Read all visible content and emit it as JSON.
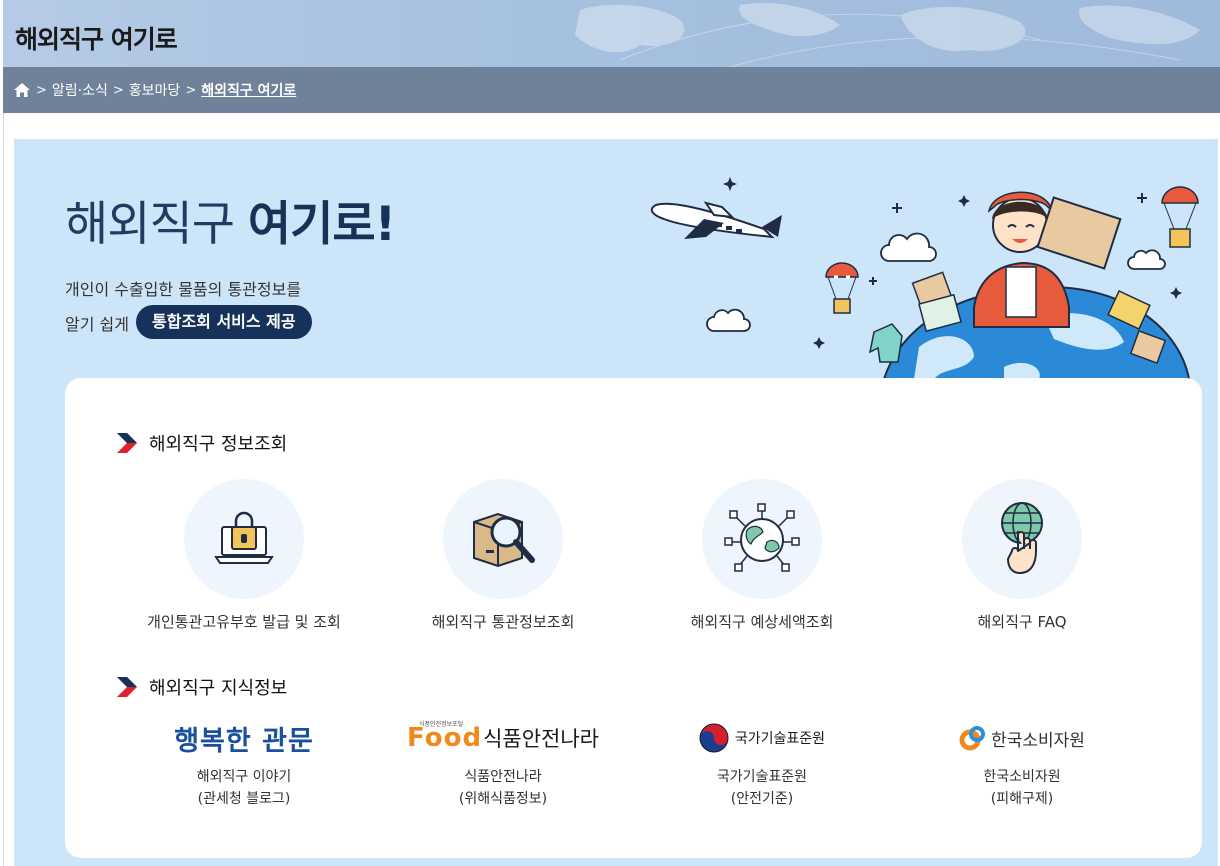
{
  "header": {
    "title": "해외직구 여기로"
  },
  "breadcrumb": {
    "items": [
      "알림·소식",
      "홍보마당",
      "해외직구 여기로"
    ],
    "separator": ">"
  },
  "hero": {
    "title_main": "해외직구",
    "title_bold": "여기로!",
    "desc_line1": "개인이 수출입한 물품의 통관정보를",
    "desc_line2": "알기 쉽게",
    "pill": "통합조회 서비스 제공"
  },
  "sections": {
    "info_lookup": {
      "title": "해외직구 정보조회",
      "items": [
        {
          "label": "개인통관고유부호 발급 및 조회",
          "icon": "laptop-lock-icon"
        },
        {
          "label": "해외직구 통관정보조회",
          "icon": "box-magnifier-icon"
        },
        {
          "label": "해외직구 예상세액조회",
          "icon": "globe-network-icon"
        },
        {
          "label": "해외직구 FAQ",
          "icon": "globe-hand-icon"
        }
      ]
    },
    "knowledge": {
      "title": "해외직구 지식정보",
      "items": [
        {
          "logo_text": "행복한 관문",
          "line1": "해외직구 이야기",
          "line2": "(관세청 블로그)"
        },
        {
          "logo_small": "식품안전정보포털",
          "logo_text": "Food",
          "logo_text2": "식품안전나라",
          "line1": "식품안전나라",
          "line2": "(위해식품정보)"
        },
        {
          "logo_text": "국가기술표준원",
          "line1": "국가기술표준원",
          "line2": "(안전기준)"
        },
        {
          "logo_text": "한국소비자원",
          "line1": "한국소비자원",
          "line2": "(피해구제)"
        }
      ]
    }
  },
  "colors": {
    "hero_bg": "#cde5f8",
    "navy": "#16325a",
    "breadcrumb_bg": "#6f8299",
    "title_bar_bg": "#a7c1e0",
    "accent_red": "#e0202f",
    "circle_bg": "#eef5fc"
  }
}
